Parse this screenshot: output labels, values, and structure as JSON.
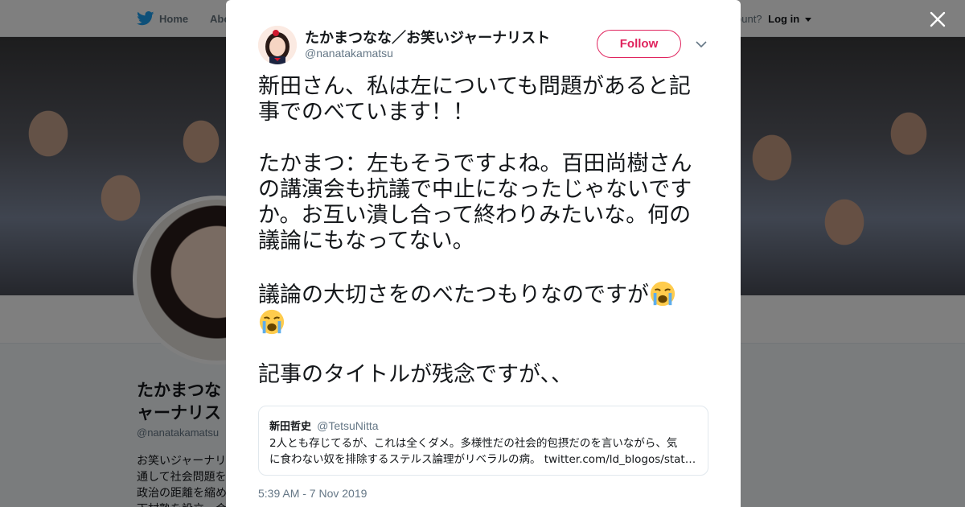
{
  "nav": {
    "home_label": "Home",
    "about_label": "Abo",
    "account_prompt": "ccount?",
    "login_label": "Log in"
  },
  "profile": {
    "name_line1": "たかまつな",
    "name_line2": "ャーナリス",
    "handle": "@nanatakamatsu",
    "bio_lines": [
      "お笑いジャーナリ",
      "通して社会問題を",
      "政治の距離を縮め",
      "下村塾を設立。会"
    ]
  },
  "tweet": {
    "author_name": "たかまつなな／お笑いジャーナリスト",
    "author_handle": "@nanatakamatsu",
    "follow_label": "Follow",
    "paragraphs": [
      "新田さん、私は左についても問題があると記事でのべています！！",
      "たかまつ：左もそうですよね。百田尚樹さんの講演会も抗議で中止になったじゃないですか。お互い潰し合って終わりみたいな。何の議論にもなってない。",
      "議論の大切さをのべたつもりなのですが",
      "記事のタイトルが残念ですが、、"
    ],
    "emoji": [
      "loudly-crying-face",
      "loudly-crying-face"
    ],
    "timestamp": "5:39 AM - 7 Nov 2019"
  },
  "quote": {
    "name": "新田哲史",
    "handle": "@TetsuNitta",
    "text_line1": "2人とも存じてるが、これは全くダメ。多様性だの社会的包摂だのを言いながら、気",
    "text_line2": "に食わない奴を排除するステルス論理がリベラルの病。",
    "link": "twitter.com/ld_blogos/stat…"
  },
  "colors": {
    "follow_accent": "#e0245e",
    "twitter_blue": "#1da1f2",
    "secondary_text": "#657786"
  }
}
